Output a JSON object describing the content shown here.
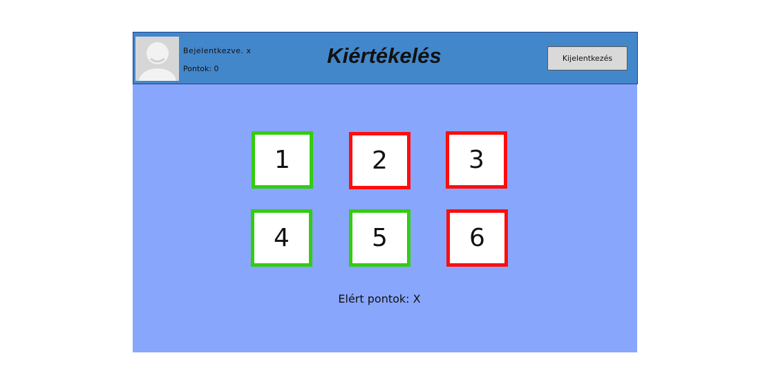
{
  "header": {
    "logged_in_label": "Bejelentkezve. x",
    "points_label": "Pontok: 0",
    "title": "Kiértékelés",
    "logout_label": "Kijelentkezés"
  },
  "answers": [
    {
      "number": "1",
      "status": "correct"
    },
    {
      "number": "2",
      "status": "wrong"
    },
    {
      "number": "3",
      "status": "wrong"
    },
    {
      "number": "4",
      "status": "correct"
    },
    {
      "number": "5",
      "status": "correct"
    },
    {
      "number": "6",
      "status": "wrong"
    }
  ],
  "result": {
    "score_text": "Elért pontok: X"
  },
  "colors": {
    "header_bg": "#4387cb",
    "content_bg": "#88a6fc",
    "correct": "#33cc11",
    "wrong": "#ff0d0d"
  },
  "icons": {
    "avatar": "user-placeholder-icon"
  }
}
